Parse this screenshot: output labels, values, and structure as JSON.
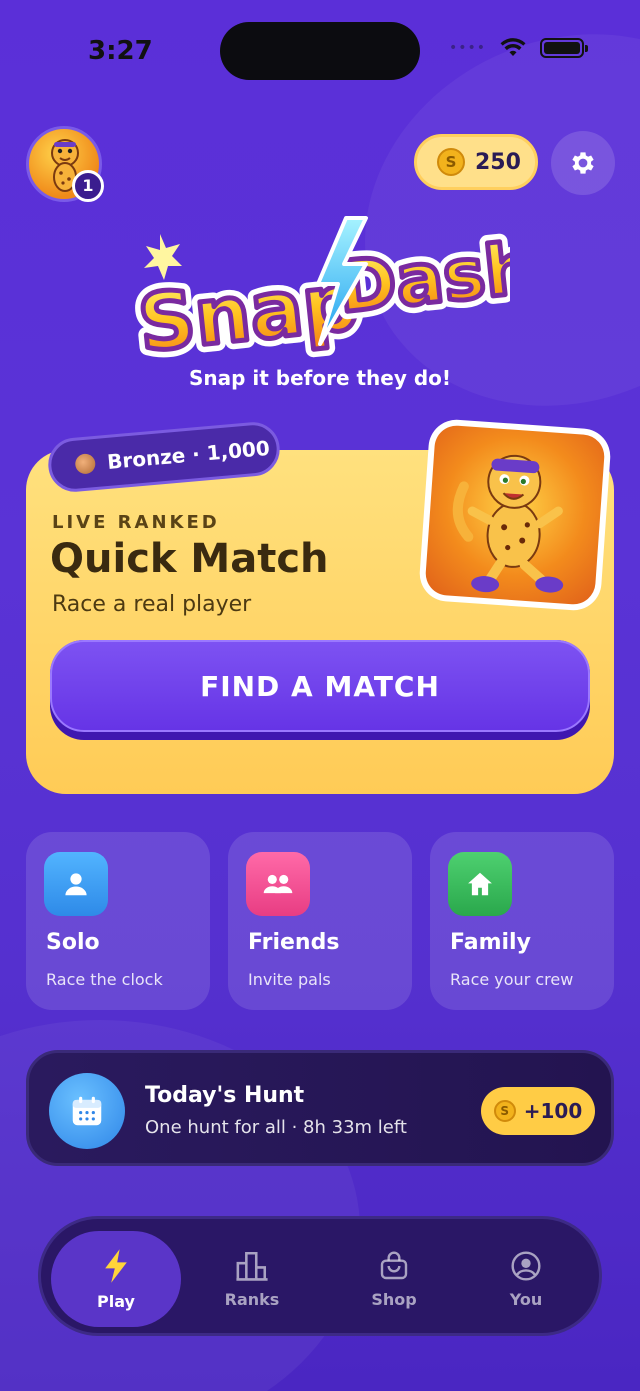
{
  "status_bar": {
    "time": "3:27"
  },
  "profile": {
    "level": "1"
  },
  "wallet": {
    "coins": "250",
    "coin_symbol": "S"
  },
  "logo": {
    "text": "SnapDash",
    "tagline": "Snap it before they do!"
  },
  "quick_match": {
    "rank_label": "Bronze · 1,000",
    "eyebrow": "LIVE RANKED",
    "title": "Quick Match",
    "subtitle": "Race a real player",
    "button_label": "FIND A MATCH"
  },
  "modes": [
    {
      "title": "Solo",
      "subtitle": "Race the clock",
      "icon": "person-icon",
      "color": "#3b9cf0"
    },
    {
      "title": "Friends",
      "subtitle": "Invite pals",
      "icon": "group-icon",
      "color": "#f0508f"
    },
    {
      "title": "Family",
      "subtitle": "Race your crew",
      "icon": "home-icon",
      "color": "#35b85a"
    }
  ],
  "daily_hunt": {
    "title": "Today's Hunt",
    "subtitle": "One hunt for all · 8h 33m left",
    "reward": "+100",
    "icon": "calendar-icon"
  },
  "tabs": [
    {
      "label": "Play",
      "icon": "bolt-icon",
      "active": true
    },
    {
      "label": "Ranks",
      "icon": "bar-chart-icon",
      "active": false
    },
    {
      "label": "Shop",
      "icon": "shopping-bag-icon",
      "active": false
    },
    {
      "label": "You",
      "icon": "user-circle-icon",
      "active": false
    }
  ],
  "colors": {
    "background": "#5a2fd6",
    "card": "#ffd163",
    "accent": "#6d3ce8",
    "coin": "#f2b21c"
  }
}
